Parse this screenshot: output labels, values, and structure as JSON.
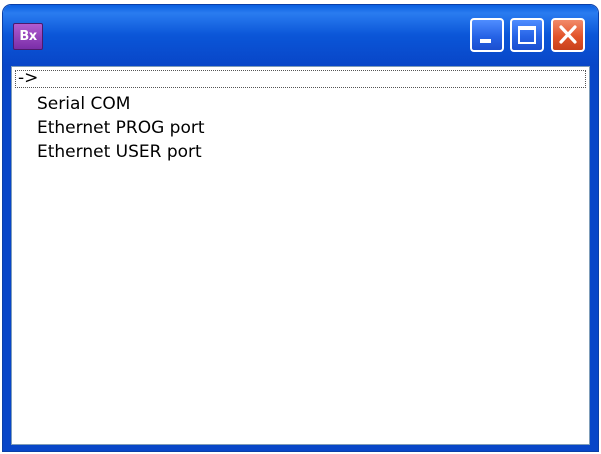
{
  "window": {
    "app_icon_text": "Bx",
    "icon": "bx-app-icon",
    "controls": {
      "minimize": "minimize-icon",
      "maximize": "maximize-icon",
      "close": "close-icon"
    },
    "colors": {
      "titlebar": "#0846c8",
      "close_button": "#e2542a",
      "app_icon": "#7a2ea8"
    }
  },
  "list": {
    "items": [
      {
        "label": "->"
      },
      {
        "label": "Serial COM"
      },
      {
        "label": "Ethernet PROG port"
      },
      {
        "label": "Ethernet USER port"
      }
    ]
  }
}
